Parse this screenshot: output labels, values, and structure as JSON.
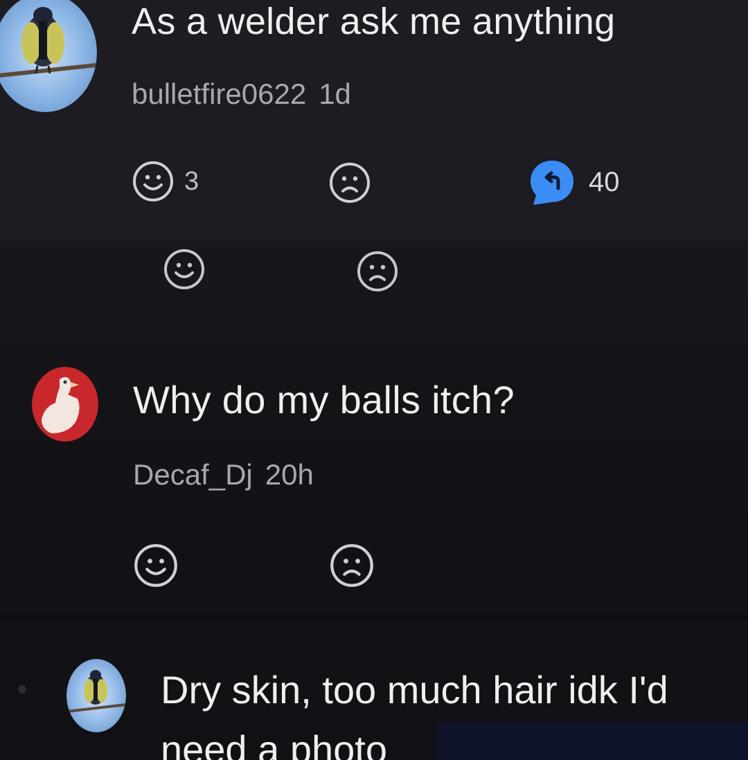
{
  "post": {
    "title": "As a welder ask me anything",
    "username": "bulletfire0622",
    "time": "1d",
    "like_count": "3",
    "reply_count": "40"
  },
  "comment": {
    "text": "Why do my balls itch?",
    "username": "Decaf_Dj",
    "time": "20h"
  },
  "reply": {
    "line1": "Dry skin, too much hair idk I'd",
    "line2": "need a photo"
  },
  "colors": {
    "background": "#141419",
    "reply_accent": "#3b8cf5",
    "comment_avatar": "#c8282c"
  },
  "icons": [
    "bird-avatar",
    "duck-avatar",
    "smiley-icon",
    "frown-icon",
    "reply-bubble-icon"
  ]
}
